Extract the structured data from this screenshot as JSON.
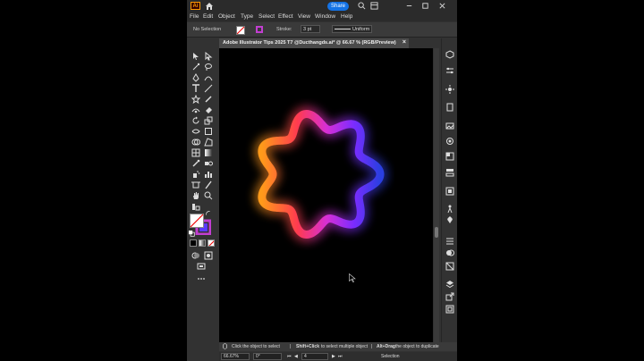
{
  "app": {
    "logo_text": "Ai",
    "share_label": "Share"
  },
  "menu": [
    "File",
    "Edit",
    "Object",
    "Type",
    "Select",
    "Effect",
    "View",
    "Window",
    "Help"
  ],
  "control_bar": {
    "selection_label": "No Selection",
    "stroke_label": "Stroke:",
    "stroke_value": "3 pt",
    "profile_label": "Uniform"
  },
  "document_tab": {
    "title": "Adobe Illustrator Tips 2025 T7 @Ducthangds.ai* @ 66.67 % (RGB/Preview)",
    "close": "×"
  },
  "status": {
    "hint1": "Click the object to select",
    "sep1": "|",
    "hint2_key": "Shift+Click",
    "hint2": " to select multiple object",
    "sep2": "|",
    "hint3_key": "Alt+Drag",
    "hint3": " the object to duplicate"
  },
  "bottom_bar": {
    "zoom": "66.67%",
    "rotation": "0°",
    "artboard": "4",
    "mode": "Selection"
  },
  "colors": {
    "accent": "#1473e6",
    "ring_gradient": [
      "#ff9a1a",
      "#ff3b4f",
      "#d62fd6",
      "#7a2cff",
      "#2a3fe0"
    ]
  },
  "icons": [
    "home-icon",
    "search-icon",
    "gear-icon",
    "close-icon",
    "selection-tool-icon",
    "pen-tool-icon",
    "type-tool-icon",
    "zoom-tool-icon",
    "hand-tool-icon"
  ]
}
